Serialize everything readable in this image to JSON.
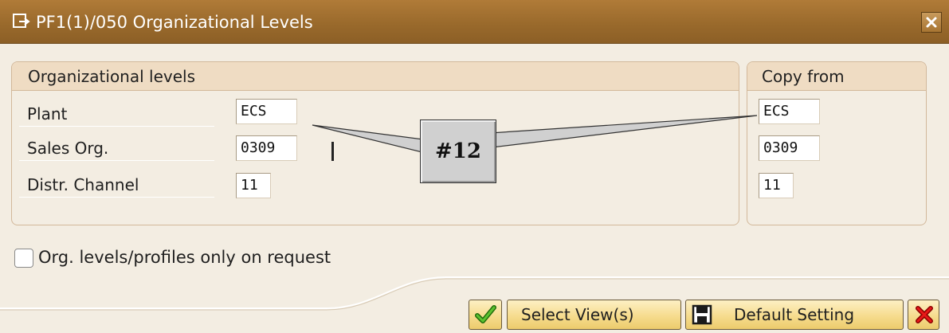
{
  "window": {
    "title": "PF1(1)/050 Organizational Levels"
  },
  "org_levels": {
    "header": "Organizational levels",
    "rows": [
      {
        "label": "Plant",
        "value": "ECS"
      },
      {
        "label": "Sales Org.",
        "value": "0309"
      },
      {
        "label": "Distr. Channel",
        "value": "11"
      }
    ]
  },
  "copy_from": {
    "header": "Copy from",
    "values": [
      "ECS",
      "0309",
      "11"
    ]
  },
  "callout": {
    "label": "#12"
  },
  "options": {
    "on_request_label": "Org. levels/profiles only on request",
    "on_request_checked": false
  },
  "buttons": {
    "confirm_icon": "checkmark-icon",
    "select_views_label": "Select View(s)",
    "default_setting_icon": "save-icon",
    "default_setting_label": "Default Setting",
    "cancel_icon": "cancel-icon"
  },
  "colors": {
    "title_bar": "#9a6a2c",
    "window_background": "#f3ede2",
    "frame_header": "#efdcc3",
    "button_face": "#f6dc8e",
    "confirm_green": "#3a9a1a",
    "cancel_red": "#d01010"
  }
}
